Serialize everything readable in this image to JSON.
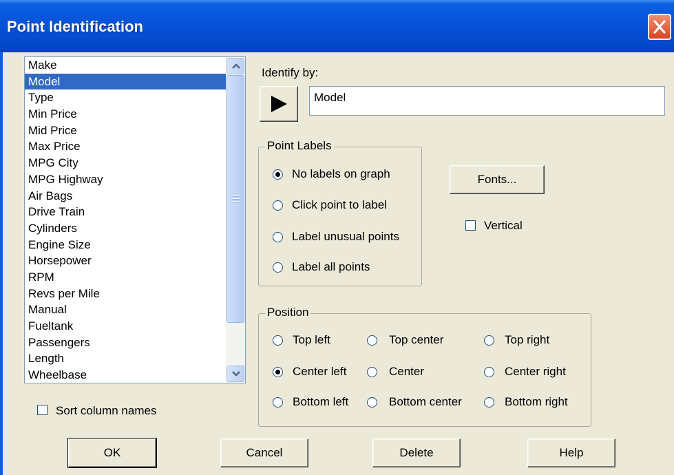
{
  "window": {
    "title": "Point Identification"
  },
  "columns": {
    "items": [
      "Make",
      "Model",
      "Type",
      "Min Price",
      "Mid Price",
      "Max Price",
      "MPG City",
      "MPG Highway",
      "Air Bags",
      "Drive Train",
      "Cylinders",
      "Engine Size",
      "Horsepower",
      "RPM",
      "Revs per Mile",
      "Manual",
      "Fueltank",
      "Passengers",
      "Length",
      "Wheelbase"
    ],
    "selected": "Model"
  },
  "sort_column_names": {
    "label": "Sort column names",
    "checked": false
  },
  "identify_by": {
    "label": "Identify by:",
    "value": "Model"
  },
  "point_labels": {
    "legend": "Point Labels",
    "options": [
      "No labels on graph",
      "Click point to label",
      "Label unusual points",
      "Label all points"
    ],
    "selected": "No labels on graph"
  },
  "fonts_button": "Fonts...",
  "vertical": {
    "label": "Vertical",
    "checked": false
  },
  "position": {
    "legend": "Position",
    "options": [
      "Top left",
      "Top center",
      "Top right",
      "Center left",
      "Center",
      "Center right",
      "Bottom left",
      "Bottom center",
      "Bottom right"
    ],
    "selected": "Center left"
  },
  "buttons": {
    "ok": "OK",
    "cancel": "Cancel",
    "delete": "Delete",
    "help": "Help"
  }
}
